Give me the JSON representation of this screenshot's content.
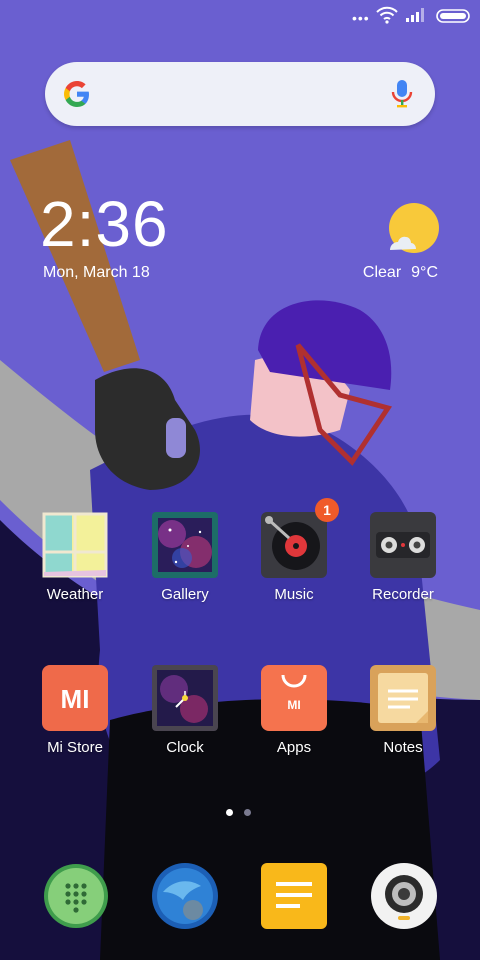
{
  "status": {
    "dots": "•••"
  },
  "clock": {
    "time": "2:36",
    "date": "Mon, March 18"
  },
  "weather": {
    "condition": "Clear",
    "temperature": "9°C"
  },
  "apps": [
    {
      "label": "Weather"
    },
    {
      "label": "Gallery"
    },
    {
      "label": "Music",
      "badge": "1"
    },
    {
      "label": "Recorder"
    },
    {
      "label": "Mi Store",
      "logo": "MI"
    },
    {
      "label": "Clock"
    },
    {
      "label": "Apps",
      "logo": "MI"
    },
    {
      "label": "Notes"
    }
  ],
  "dock": [
    "dialer-icon",
    "browser-icon",
    "messages-icon",
    "camera-icon"
  ],
  "colors": {
    "wallpaper": "#6a5fd0",
    "accent_badge": "#f05a2a",
    "mi_orange": "#ef6a4a"
  }
}
